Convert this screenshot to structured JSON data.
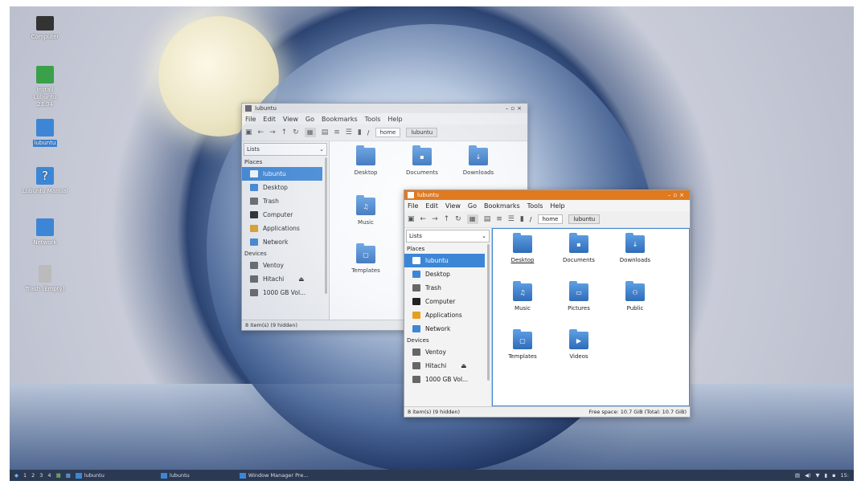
{
  "desktop_icons": [
    {
      "label": "Computer",
      "icon": "monitor-icon"
    },
    {
      "label": "Install Lubuntu 23.04",
      "icon": "installer-icon"
    },
    {
      "label": "lubuntu",
      "icon": "home-folder-icon"
    },
    {
      "label": "Lubuntu Manual",
      "icon": "help-icon"
    },
    {
      "label": "Network",
      "icon": "network-icon"
    },
    {
      "label": "Trash (Empty)",
      "icon": "trash-icon"
    }
  ],
  "windows": [
    {
      "title": "lubuntu",
      "menu": [
        "File",
        "Edit",
        "View",
        "Go",
        "Bookmarks",
        "Tools",
        "Help"
      ],
      "path": [
        "/",
        "home",
        "lubuntu"
      ],
      "side_dropdown": "Lists",
      "places_header": "Places",
      "places": [
        "lubuntu",
        "Desktop",
        "Trash",
        "Computer",
        "Applications",
        "Network"
      ],
      "devices_header": "Devices",
      "devices": [
        "Ventoy",
        "Hitachi",
        "1000 GB Vol..."
      ],
      "folders": [
        "Desktop",
        "Documents",
        "Downloads",
        "Music",
        "Templates"
      ],
      "status": "8 item(s) (9 hidden)",
      "free_space": ""
    },
    {
      "title": "lubuntu",
      "menu": [
        "File",
        "Edit",
        "View",
        "Go",
        "Bookmarks",
        "Tools",
        "Help"
      ],
      "path": [
        "/",
        "home",
        "lubuntu"
      ],
      "side_dropdown": "Lists",
      "places_header": "Places",
      "places": [
        "lubuntu",
        "Desktop",
        "Trash",
        "Computer",
        "Applications",
        "Network"
      ],
      "devices_header": "Devices",
      "devices": [
        "Ventoy",
        "Hitachi",
        "1000 GB Vol..."
      ],
      "folders": [
        "Desktop",
        "Documents",
        "Downloads",
        "Music",
        "Pictures",
        "Public",
        "Templates",
        "Videos"
      ],
      "status": "8 item(s) (9 hidden)",
      "free_space": "Free space: 10.7 GiB (Total: 10.7 GiB)"
    }
  ],
  "taskbar": {
    "workspaces": [
      "1",
      "2",
      "3",
      "4"
    ],
    "tasks": [
      "lubuntu",
      "lubuntu",
      "Window Manager Pre..."
    ],
    "clock": "15:"
  },
  "colors": {
    "accent": "#3d86d6",
    "active_title": "#e07a1f",
    "taskbar": "#2b3a52"
  }
}
